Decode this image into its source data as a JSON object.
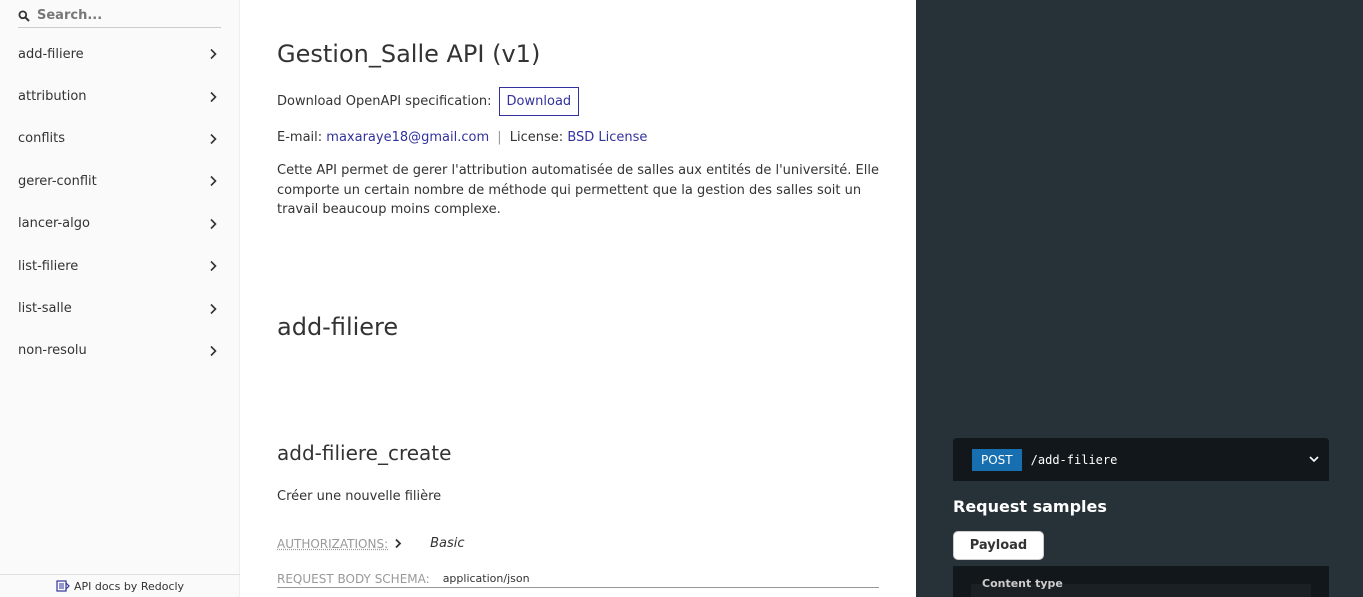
{
  "sidebar": {
    "search_placeholder": "Search...",
    "items": [
      {
        "label": "add-filiere"
      },
      {
        "label": "attribution"
      },
      {
        "label": "conflits"
      },
      {
        "label": "gerer-conflit"
      },
      {
        "label": "lancer-algo"
      },
      {
        "label": "list-filiere"
      },
      {
        "label": "list-salle"
      },
      {
        "label": "non-resolu"
      }
    ],
    "footer": "API docs by Redocly"
  },
  "main": {
    "title": "Gestion_Salle API (v1)",
    "download_label": "Download OpenAPI specification:",
    "download_button": "Download",
    "email_label": "E-mail:",
    "email": "maxaraye18@gmail.com",
    "separator": "|",
    "license_label": "License:",
    "license": "BSD License",
    "description": "Cette API permet de gerer l'attribution automatisée de salles aux entités de l'université. Elle comporte un certain nombre de méthode qui permettent que la gestion des salles soit un travail beaucoup moins complexe.",
    "section_title": "add-filiere",
    "operation_title": "add-filiere_create",
    "operation_description": "Créer une nouvelle filière",
    "authorizations_label": "AUTHORIZATIONS:",
    "authorizations_value": "Basic",
    "request_body_label": "REQUEST BODY SCHEMA:",
    "request_body_value": "application/json"
  },
  "right_panel": {
    "method": "POST",
    "path": "/add-filiere",
    "request_samples_title": "Request samples",
    "tab_label": "Payload",
    "content_type_label": "Content type"
  },
  "colors": {
    "link": "#32329f",
    "dark_panel": "#263238",
    "code_bg": "#11171a",
    "method_post": "#186faf"
  },
  "icons": [
    "search-icon",
    "chevron-right-icon",
    "redocly-logo-icon",
    "chevron-down-icon"
  ]
}
